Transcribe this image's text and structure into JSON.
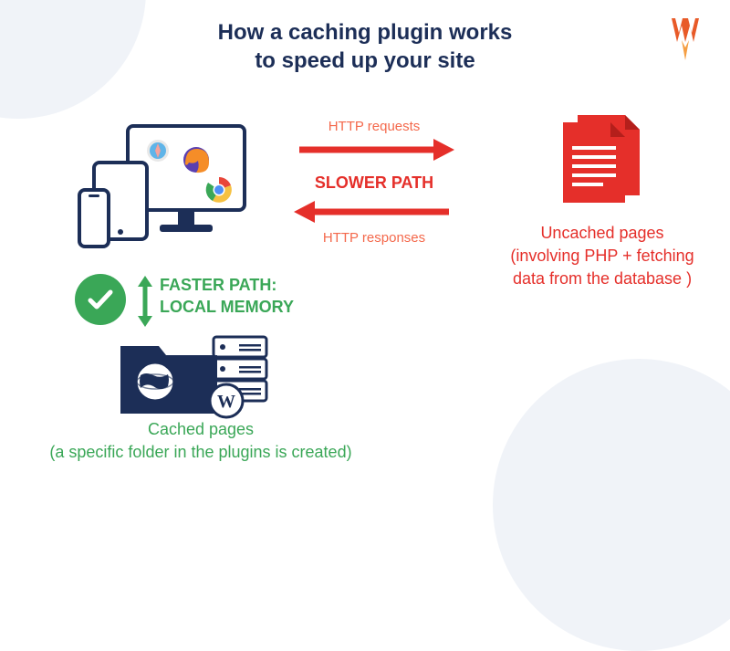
{
  "title_line1": "How a caching plugin works",
  "title_line2": "to speed up your site",
  "http_requests_label": "HTTP requests",
  "slower_path_label": "SLOWER PATH",
  "http_responses_label": "HTTP responses",
  "uncached_line1": "Uncached pages",
  "uncached_line2": "(involving PHP + fetching",
  "uncached_line3": "data from the database )",
  "faster_path_line1": "FASTER PATH:",
  "faster_path_line2": "LOCAL MEMORY",
  "cached_line1": "Cached pages",
  "cached_line2": "(a specific folder in the plugins is created)",
  "colors": {
    "navy": "#1c2e57",
    "red": "#e52f2a",
    "salmon": "#f4694c",
    "green": "#3aa757"
  }
}
